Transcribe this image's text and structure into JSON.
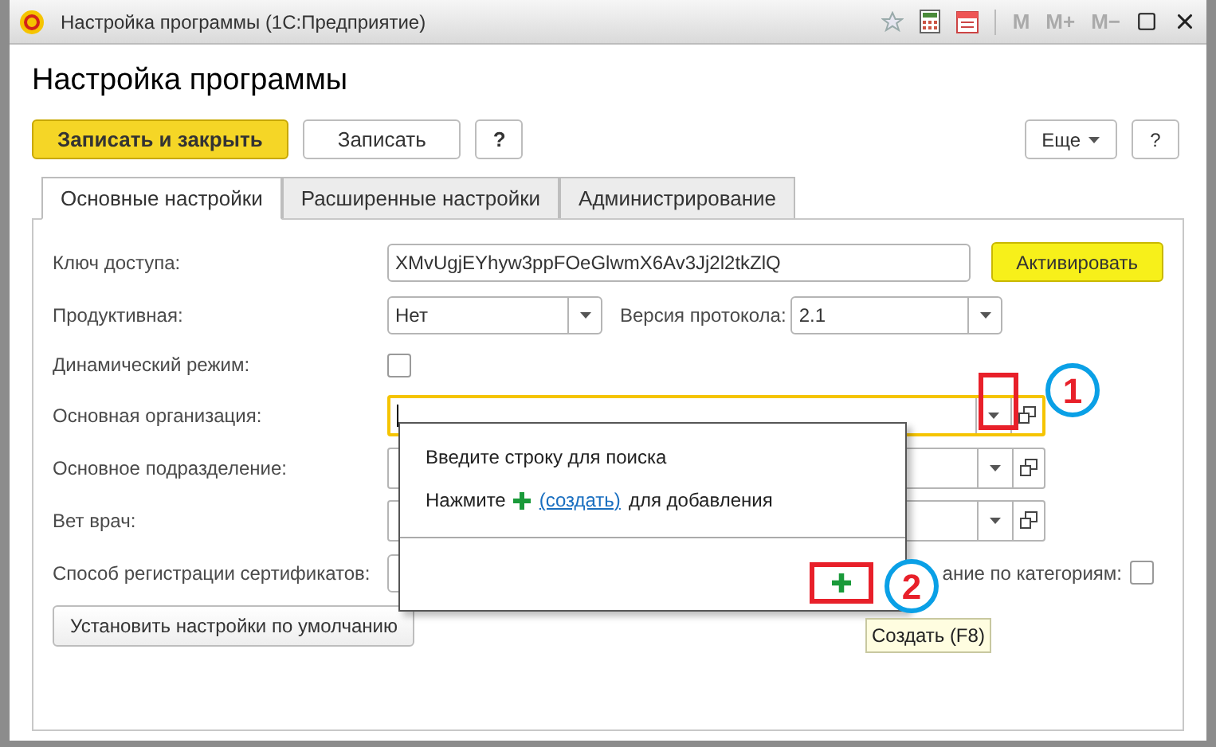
{
  "window": {
    "title": "Настройка программы (1С:Предприятие)",
    "memory_buttons": [
      "M",
      "M+",
      "M−"
    ]
  },
  "heading": "Настройка программы",
  "toolbar": {
    "buttons": [
      {
        "label": "Записать и закрыть",
        "kind": "primary"
      },
      {
        "label": "Записать",
        "kind": "plain"
      },
      {
        "label": "?",
        "kind": "bold"
      }
    ],
    "more": "Еще",
    "help": "?"
  },
  "tabs": [
    {
      "label": "Основные настройки",
      "selected": true
    },
    {
      "label": "Расширенные настройки",
      "selected": false
    },
    {
      "label": "Администрирование",
      "selected": false
    }
  ],
  "fields": [
    {
      "kind": "text",
      "label": "Ключ доступа:",
      "value": "XMvUgjEYhyw3ppFOeGlwmX6Av3Jj2l2tkZlQ",
      "action": "Активировать"
    },
    {
      "kind": "select",
      "label": "Продуктивная:",
      "value": "Нет",
      "extra_label": "Версия протокола:",
      "extra_value": "2.1"
    },
    {
      "kind": "checkbox",
      "label": "Динамический режим:",
      "checked": false
    },
    {
      "kind": "reference",
      "label": "Основная организация:",
      "focused": true
    },
    {
      "kind": "reference",
      "label": "Основное подразделение:",
      "focused": false
    },
    {
      "kind": "reference",
      "label": "Вет врач:",
      "focused": false
    },
    {
      "kind": "split",
      "label": "Способ регистрации сертификатов:",
      "extra_label": "ание по категориям:",
      "checked": false
    }
  ],
  "default_button": "Установить настройки по умолчанию",
  "popup": {
    "hint": "Введите строку для поиска",
    "press": "Нажмите",
    "link": "(создать)",
    "suffix": "для добавления"
  },
  "tooltip": "Создать (F8)",
  "annotations": [
    {
      "number": "1"
    },
    {
      "number": "2"
    }
  ]
}
